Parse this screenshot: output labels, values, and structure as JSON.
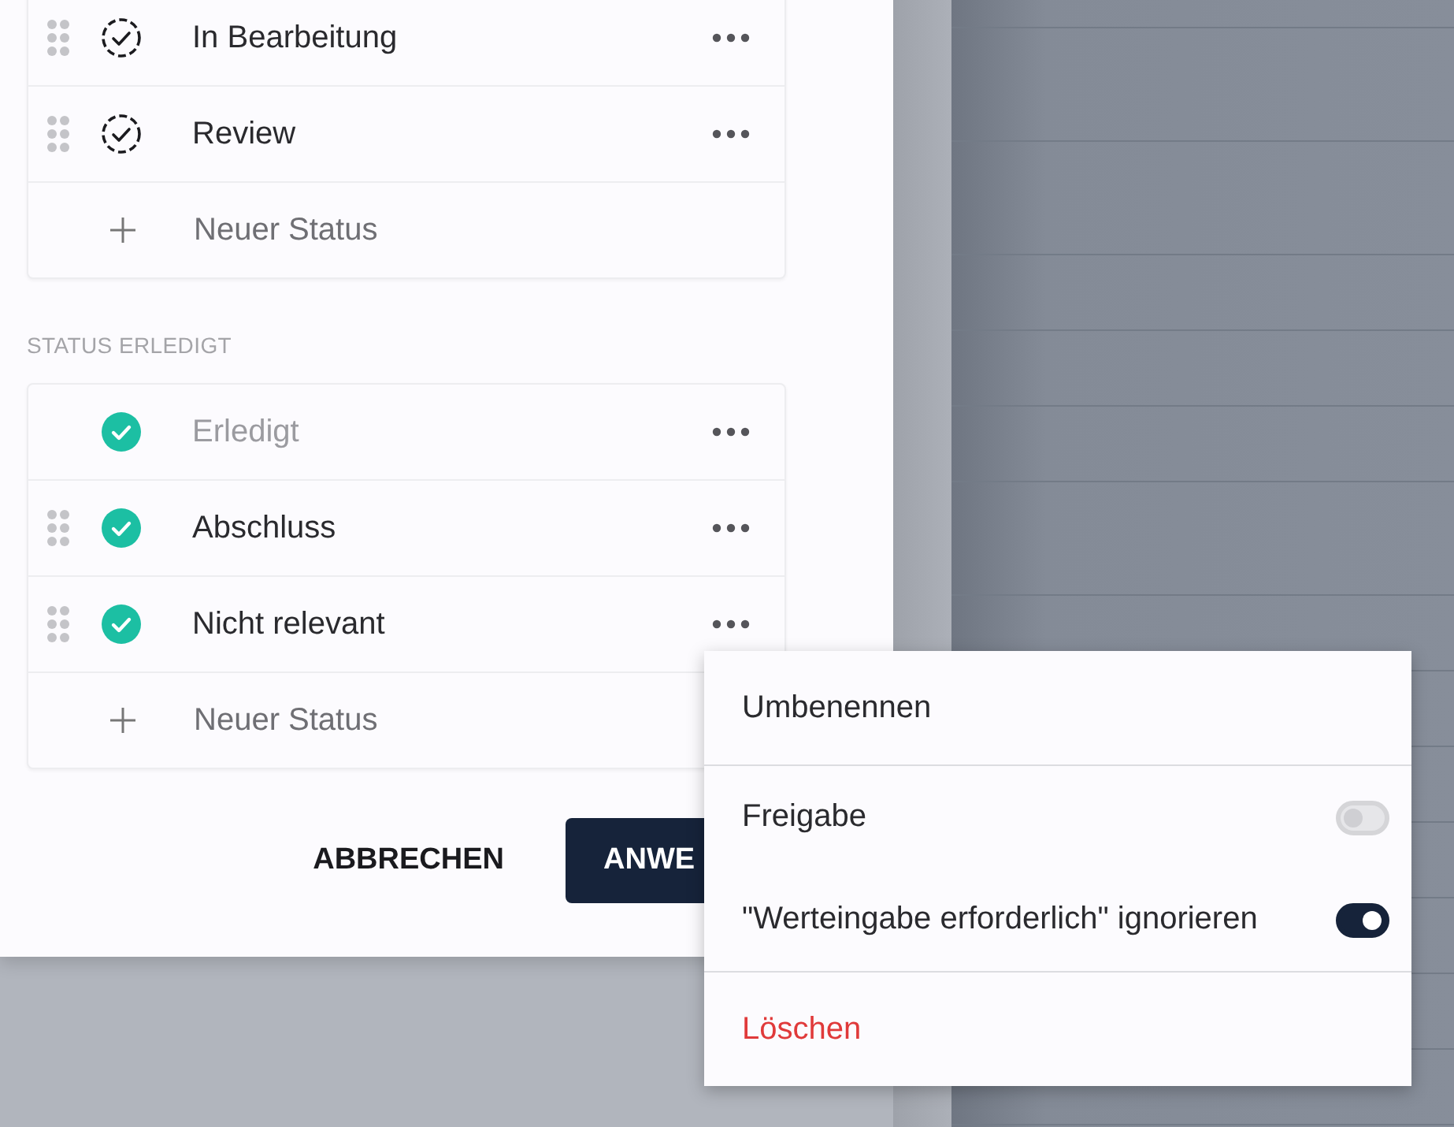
{
  "groups": [
    {
      "items": [
        {
          "name": "In Bearbeitung",
          "kind": "open",
          "draggable": true,
          "disabled": false
        },
        {
          "name": "Review",
          "kind": "open",
          "draggable": true,
          "disabled": false
        }
      ],
      "add_label": "Neuer Status"
    },
    {
      "heading": "STATUS ERLEDIGT",
      "items": [
        {
          "name": "Erledigt",
          "kind": "done",
          "draggable": false,
          "disabled": true
        },
        {
          "name": "Abschluss",
          "kind": "done",
          "draggable": true,
          "disabled": false
        },
        {
          "name": "Nicht relevant",
          "kind": "done",
          "draggable": true,
          "disabled": false
        }
      ],
      "add_label": "Neuer Status"
    }
  ],
  "buttons": {
    "cancel": "ABBRECHEN",
    "apply": "ANWE"
  },
  "menu": {
    "items": [
      {
        "kind": "action",
        "label": "Umbenennen"
      },
      {
        "kind": "toggle",
        "label": "Freigabe",
        "on": false
      },
      {
        "kind": "toggle",
        "label": "\"Werteingabe erforderlich\" ignorieren",
        "on": true
      },
      {
        "kind": "danger",
        "label": "Löschen"
      }
    ]
  }
}
